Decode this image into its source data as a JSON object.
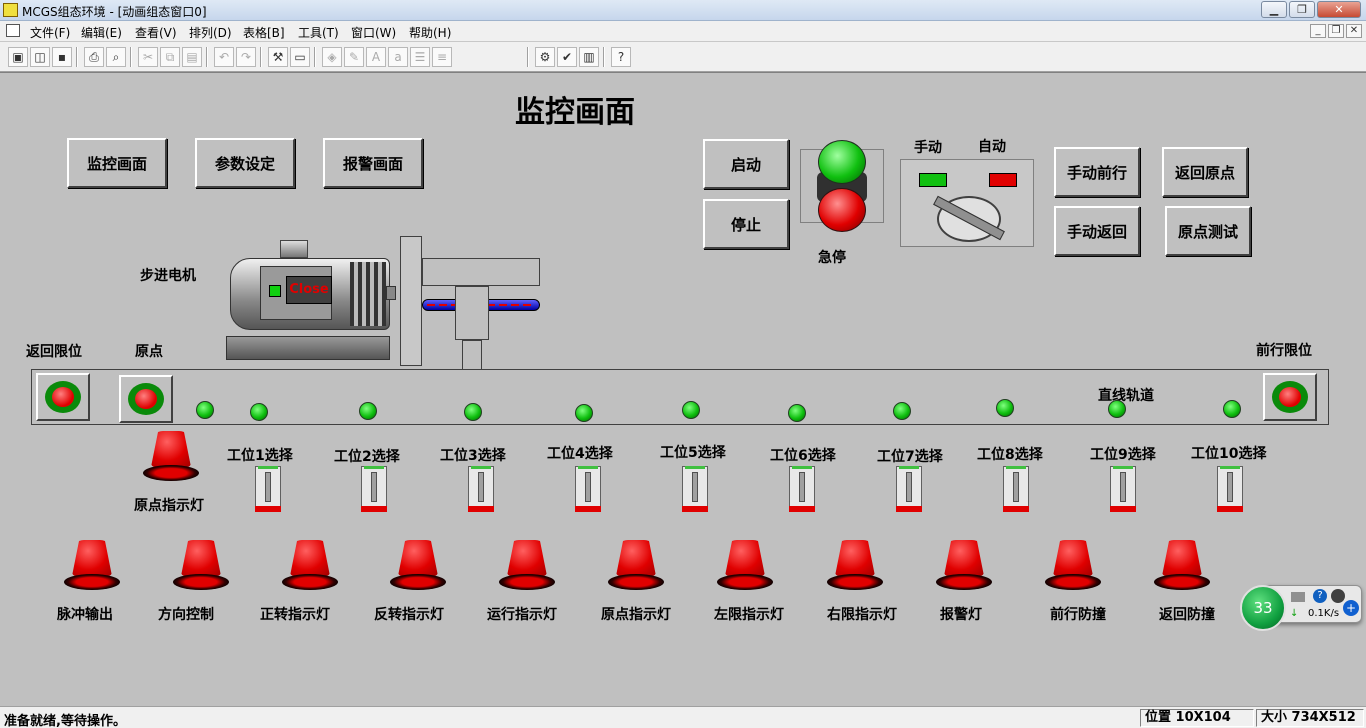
{
  "window": {
    "title": "MCGS组态环境 - [动画组态窗口0]"
  },
  "menu": [
    "文件(F)",
    "编辑(E)",
    "查看(V)",
    "排列(D)",
    "表格[B]",
    "工具(T)",
    "窗口(W)",
    "帮助(H)"
  ],
  "screen": {
    "title": "监控画面",
    "nav_buttons": [
      "监控画面",
      "参数设定",
      "报警画面"
    ],
    "start_label": "启动",
    "stop_label": "停止",
    "estop_label": "急停",
    "manual_label": "手动",
    "auto_label": "自动",
    "right_buttons": [
      "手动前行",
      "返回原点",
      "手动返回",
      "原点测试"
    ],
    "motor_label": "步进电机",
    "motor_text": "Close",
    "home_limit_label": "返回限位",
    "origin_label": "原点",
    "forward_limit_label": "前行限位",
    "track_label": "直线轨道",
    "origin_indicator_label": "原点指示灯",
    "stations": [
      "工位1选择",
      "工位2选择",
      "工位3选择",
      "工位4选择",
      "工位5选择",
      "工位6选择",
      "工位7选择",
      "工位8选择",
      "工位9选择",
      "工位10选择"
    ],
    "lamps": [
      "脉冲输出",
      "方向控制",
      "正转指示灯",
      "反转指示灯",
      "运行指示灯",
      "原点指示灯",
      "左限指示灯",
      "右限指示灯",
      "报警灯",
      "前行防撞",
      "返回防撞"
    ]
  },
  "widget": {
    "value": "33",
    "speed": "0.1K/s"
  },
  "status": {
    "message": "准备就绪,等待操作。",
    "position": "位置 10X104",
    "size": "大小 734X512"
  },
  "colors": {
    "canvas": "#c0c0c0",
    "lamp_red": "#e00000",
    "indicator_green": "#10c010"
  }
}
